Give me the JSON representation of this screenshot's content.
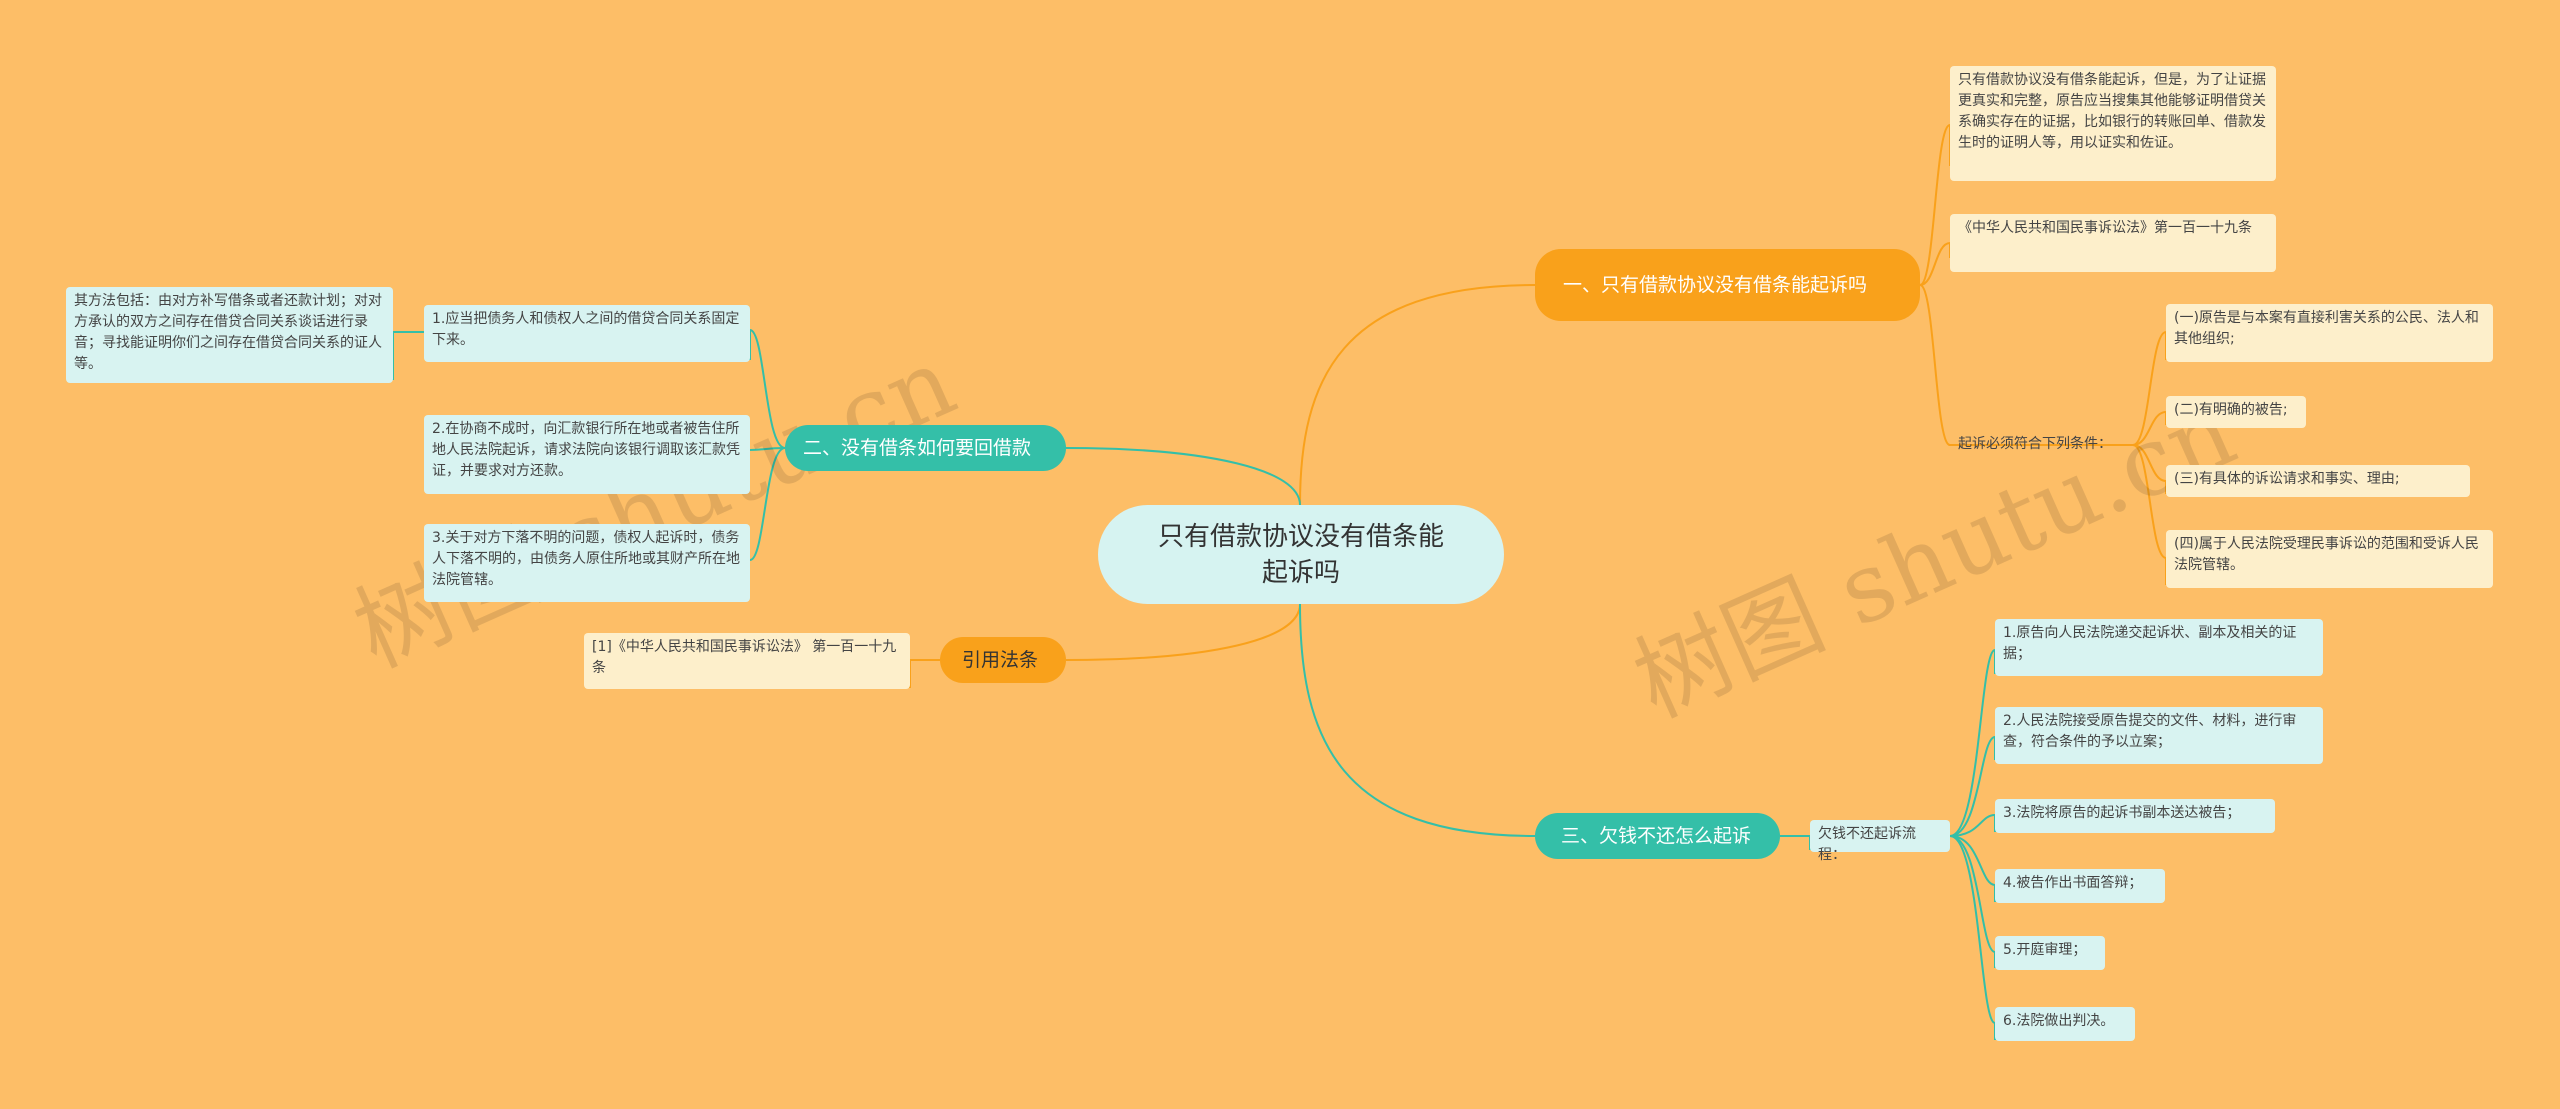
{
  "root": {
    "title": "只有借款协议没有借条能起诉吗"
  },
  "branch1": {
    "title": "一、只有借款协议没有借条能起诉吗",
    "note": "只有借款协议没有借条能起诉，但是，为了让证据更真实和完整，原告应当搜集其他能够证明借贷关系确实存在的证据，比如银行的转账回单、借款发生时的证明人等，用以证实和佐证。",
    "law": "《中华人民共和国民事诉讼法》第一百一十九条",
    "conditions_label": "起诉必须符合下列条件：",
    "conditions": [
      "(一)原告是与本案有直接利害关系的公民、法人和其他组织;",
      "(二)有明确的被告;",
      "(三)有具体的诉讼请求和事实、理由;",
      "(四)属于人民法院受理民事诉讼的范围和受诉人民法院管辖。"
    ]
  },
  "branch2": {
    "title": "二、没有借条如何要回借款",
    "items": [
      "1.应当把债务人和债权人之间的借贷合同关系固定下来。",
      "2.在协商不成时，向汇款银行所在地或者被告住所地人民法院起诉，请求法院向该银行调取该汇款凭证，并要求对方还款。",
      "3.关于对方下落不明的问题，债权人起诉时，债务人下落不明的，由债务人原住所地或其财产所在地法院管辖。"
    ],
    "method": "其方法包括：由对方补写借条或者还款计划；对对方承认的双方之间存在借贷合同关系谈话进行录音；寻找能证明你们之间存在借贷合同关系的证人等。"
  },
  "branch3": {
    "title": "引用法条",
    "item": "[1]《中华人民共和国民事诉讼法》 第一百一十九条"
  },
  "branch4": {
    "title": "三、欠钱不还怎么起诉",
    "process_label": "欠钱不还起诉流程：",
    "steps": [
      "1.原告向人民法院递交起诉状、副本及相关的证据；",
      "2.人民法院接受原告提交的文件、材料，进行审查，符合条件的予以立案；",
      "3.法院将原告的起诉书副本送达被告；",
      "4.被告作出书面答辩；",
      "5.开庭审理；",
      "6.法院做出判决。"
    ]
  },
  "watermark": "树图 shutu.cn",
  "colors": {
    "background": "#FDBE67",
    "orange": "#F9A11B",
    "teal": "#34BFA8",
    "cream": "#FDEFCB",
    "cyan": "#D8F3F1"
  }
}
